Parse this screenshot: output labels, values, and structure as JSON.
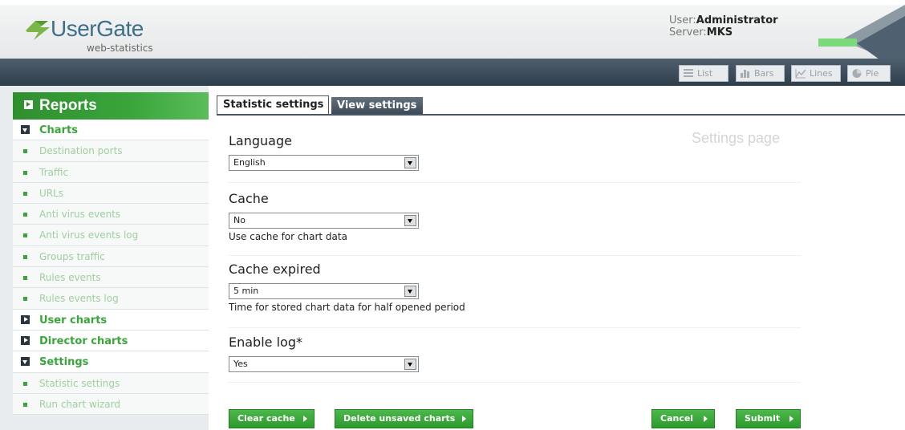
{
  "header": {
    "logo_text": "UserGate",
    "logo_sub": "web-statistics",
    "user_label": "User:",
    "user_value": "Administrator",
    "server_label": "Server:",
    "server_value": "MKS"
  },
  "toolbar": {
    "buttons": [
      {
        "label": "List",
        "icon": "list-icon"
      },
      {
        "label": "Bars",
        "icon": "bars-icon"
      },
      {
        "label": "Lines",
        "icon": "lines-icon"
      },
      {
        "label": "Pie",
        "icon": "pie-icon"
      }
    ]
  },
  "sidebar": {
    "title": "Reports",
    "items": [
      {
        "label": "Charts",
        "type": "section",
        "expanded": true
      },
      {
        "label": "Destination ports",
        "type": "sub"
      },
      {
        "label": "Traffic",
        "type": "sub"
      },
      {
        "label": "URLs",
        "type": "sub"
      },
      {
        "label": "Anti virus events",
        "type": "sub"
      },
      {
        "label": "Anti virus events log",
        "type": "sub"
      },
      {
        "label": "Groups traffic",
        "type": "sub"
      },
      {
        "label": "Rules events",
        "type": "sub"
      },
      {
        "label": "Rules events log",
        "type": "sub"
      },
      {
        "label": "User charts",
        "type": "section",
        "expanded": false
      },
      {
        "label": "Director charts",
        "type": "section",
        "expanded": false
      },
      {
        "label": "Settings",
        "type": "section",
        "expanded": true
      },
      {
        "label": "Statistic settings",
        "type": "sub"
      },
      {
        "label": "Run chart wizard",
        "type": "sub"
      }
    ]
  },
  "tabs": [
    {
      "label": "Statistic settings",
      "active": true
    },
    {
      "label": "View settings",
      "active": false
    }
  ],
  "main": {
    "page_title": "Settings page",
    "fields": [
      {
        "label": "Language",
        "value": "English",
        "help": ""
      },
      {
        "label": "Cache",
        "value": "No",
        "help": "Use cache for chart data"
      },
      {
        "label": "Cache expired",
        "value": "5 min",
        "help": "Time for stored chart data for half opened period"
      },
      {
        "label": "Enable log*",
        "value": "Yes",
        "help": ""
      }
    ],
    "buttons": {
      "clear_cache": "Clear cache",
      "delete_unsaved": "Delete unsaved charts",
      "cancel": "Cancel",
      "submit": "Submit"
    }
  },
  "colors": {
    "accent_green": "#3aa53a",
    "toolbar_dark": "#2f3e4b",
    "logo_blue": "#3d6f8a"
  }
}
